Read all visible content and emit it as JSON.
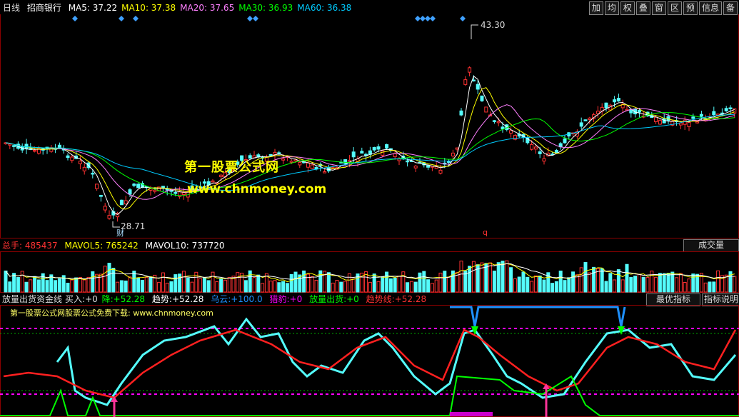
{
  "header": {
    "period": "日线",
    "stock_name": "招商银行",
    "ma": [
      {
        "label": "MA5:",
        "value": "37.22",
        "color": "#ffffff"
      },
      {
        "label": "MA10:",
        "value": "37.38",
        "color": "#ffff00"
      },
      {
        "label": "MA20:",
        "value": "37.65",
        "color": "#ff80ff"
      },
      {
        "label": "MA30:",
        "value": "36.93",
        "color": "#00ff00"
      },
      {
        "label": "MA60:",
        "value": "36.38",
        "color": "#00ccff"
      }
    ]
  },
  "toolbar": [
    "加",
    "均",
    "权",
    "叠",
    "窗",
    "区",
    "预",
    "信息",
    "备"
  ],
  "price_chart": {
    "high_label": "43.30",
    "low_label": "28.71",
    "cai_marker": "财",
    "q_marker": "q",
    "watermark_title": "第一股票公式网",
    "watermark_url": "www.chnmoney.com"
  },
  "volume": {
    "total_label": "总手:",
    "total_value": "485437",
    "mavol5_label": "MAVOL5:",
    "mavol5_value": "765242",
    "mavol10_label": "MAVOL10:",
    "mavol10_value": "737720",
    "button": "成交量"
  },
  "indicator": {
    "name": "放量出货资金线",
    "buy_label": "买入:",
    "buy_value": "+0",
    "down_label": "降:",
    "down_value": "+52.28",
    "trend_label": "趋势:",
    "trend_value": "+52.28",
    "cloud_label": "乌云:",
    "cloud_value": "+100.0",
    "hunt_label": "猎豹:",
    "hunt_value": "+0",
    "dump_label": "放量出货:",
    "dump_value": "+0",
    "trendline_label": "趋势线:",
    "trendline_value": "+52.28",
    "best_button": "最优指标",
    "help_button": "指标说明",
    "note": "第一股票公式网股票公式免费下载: www.chnmoney.com"
  },
  "colors": {
    "up": "#ff3232",
    "down": "#54fcfc",
    "border": "#8b0000",
    "magenta": "#ff00ff",
    "green": "#00ff00",
    "blue": "#1e90ff"
  }
}
